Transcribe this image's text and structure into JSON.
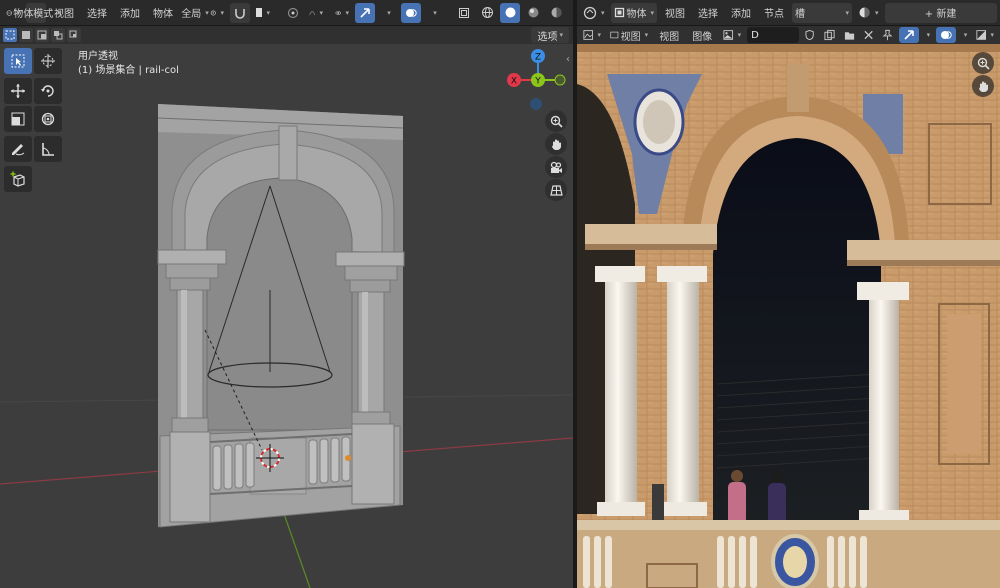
{
  "viewport": {
    "header": {
      "mode_label": "物体模式",
      "menus": [
        "视图",
        "选择",
        "添加",
        "物体"
      ],
      "orientation_label": "全局"
    },
    "options_label": "选项",
    "info_line1": "用户透视",
    "info_line2": "(1) 场景集合 | rail-col",
    "gizmo": {
      "x": "X",
      "y": "Y",
      "z": "Z"
    }
  },
  "image_editor": {
    "header": {
      "mode_label": "物体",
      "menus": [
        "视图",
        "选择",
        "添加",
        "节点"
      ],
      "slot_label": "槽",
      "new_label": "+ 新建"
    },
    "sub": {
      "menus": [
        "视图",
        "视图",
        "图像"
      ],
      "image_name": "D"
    }
  },
  "colors": {
    "viewport_bg": "#3d3d3d",
    "header_bg": "#2a2a2a",
    "accent_blue": "#4772b3",
    "axis_x": "#e2384a",
    "axis_y": "#8bc51b",
    "axis_z": "#3b8ee6"
  }
}
